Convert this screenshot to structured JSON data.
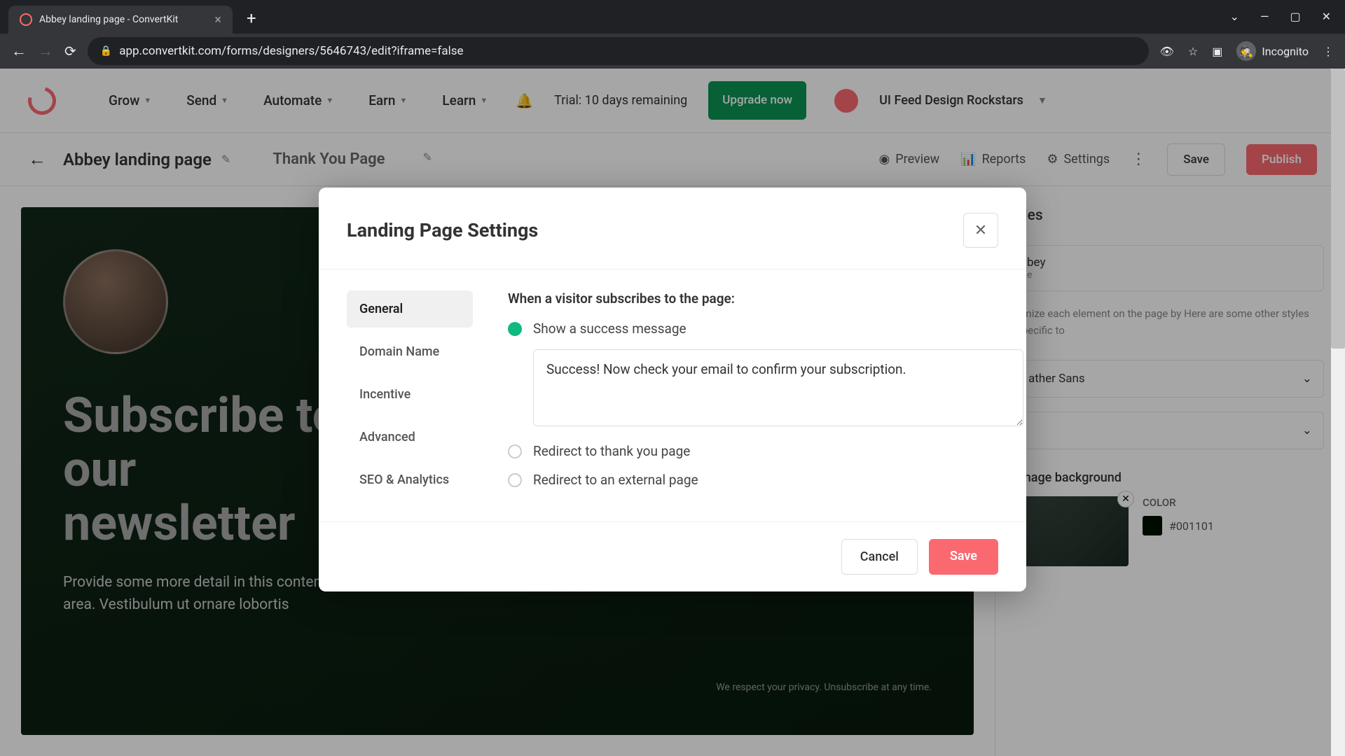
{
  "browser": {
    "tab_title": "Abbey landing page - ConvertKit",
    "url": "app.convertkit.com/forms/designers/5646743/edit?iframe=false",
    "incognito_label": "Incognito"
  },
  "top_nav": {
    "items": [
      "Grow",
      "Send",
      "Automate",
      "Earn",
      "Learn"
    ],
    "trial_text": "Trial: 10 days remaining",
    "upgrade_label": "Upgrade now",
    "account_name": "UI Feed Design Rockstars"
  },
  "sub_header": {
    "page_name": "Abbey landing page",
    "tab_label": "Thank You Page",
    "actions": {
      "preview": "Preview",
      "reports": "Reports",
      "settings": "Settings"
    },
    "save_label": "Save",
    "publish_label": "Publish"
  },
  "landing": {
    "title": "Subscribe to our newsletter",
    "desc": "Provide some more detail in this content area. Vestibulum ut ornare lobortis",
    "privacy": "We respect your privacy. Unsubscribe at any time."
  },
  "right_panel": {
    "title": "yles",
    "template_name": "bey",
    "template_sub": "e",
    "desc": "omize each element on the page by Here are some other styles specific to",
    "font_value": "ather Sans",
    "bg_section": "Image background",
    "color_label": "COLOR",
    "color_value": "#001101"
  },
  "modal": {
    "title": "Landing Page Settings",
    "tabs": [
      "General",
      "Domain Name",
      "Incentive",
      "Advanced",
      "SEO & Analytics"
    ],
    "section_title": "When a visitor subscribes to the page:",
    "options": {
      "success": "Show a success message",
      "thank_you": "Redirect to thank you page",
      "external": "Redirect to an external page"
    },
    "success_message": "Success! Now check your email to confirm your subscription.",
    "cancel_label": "Cancel",
    "save_label": "Save"
  }
}
